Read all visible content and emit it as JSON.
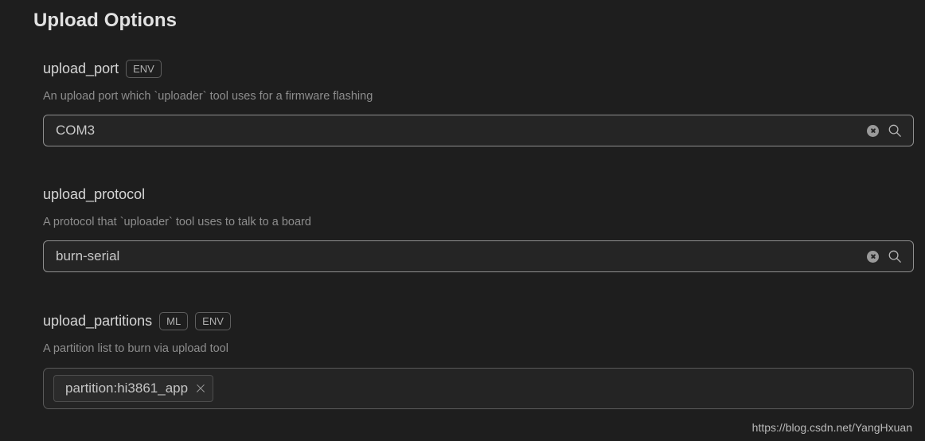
{
  "page": {
    "title": "Upload Options",
    "background_color": "#1e1e1e",
    "watermark": "https://blog.csdn.net/YangHxuan"
  },
  "options": [
    {
      "name": "upload_port",
      "badges": [
        "ENV"
      ],
      "description": "An upload port which `uploader` tool uses for a firmware flashing",
      "field_type": "text",
      "value": "COM3",
      "placeholder": "",
      "icons": [
        "clear-icon",
        "search-icon"
      ]
    },
    {
      "name": "upload_protocol",
      "badges": [],
      "description": "A protocol that `uploader` tool uses to talk to a board",
      "field_type": "text",
      "value": "burn-serial",
      "placeholder": "",
      "icons": [
        "clear-icon",
        "search-icon"
      ]
    },
    {
      "name": "upload_partitions",
      "badges": [
        "ML",
        "ENV"
      ],
      "description": "A partition list to burn via upload tool",
      "field_type": "tags",
      "tags": [
        "partition:hi3861_app"
      ]
    }
  ]
}
